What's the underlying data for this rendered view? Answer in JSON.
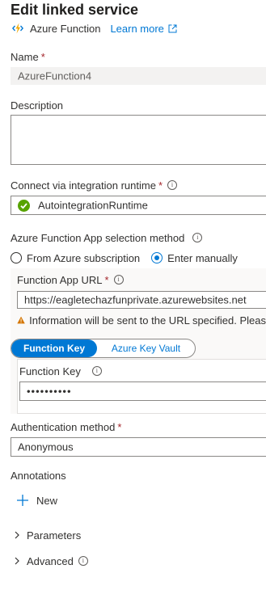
{
  "header": {
    "title": "Edit linked service",
    "service_type": "Azure Function",
    "learn_more": "Learn more"
  },
  "name": {
    "label": "Name",
    "required": "*",
    "value": "AzureFunction4"
  },
  "description": {
    "label": "Description",
    "value": ""
  },
  "runtime": {
    "label": "Connect via integration runtime",
    "required": "*",
    "value": "AutointegrationRuntime"
  },
  "selection_method": {
    "label": "Azure Function App selection method",
    "options": [
      "From Azure subscription",
      "Enter manually"
    ],
    "selected": "Enter manually"
  },
  "function_app_url": {
    "label": "Function App URL",
    "required": "*",
    "value": "https://eagletechazfunprivate.azurewebsites.net",
    "warning": "Information will be sent to the URL specified. Pleas"
  },
  "key_source": {
    "options": [
      "Function Key",
      "Azure Key Vault"
    ],
    "selected": "Function Key"
  },
  "function_key": {
    "label": "Function Key",
    "value": "••••••••••"
  },
  "auth": {
    "label": "Authentication method",
    "required": "*",
    "value": "Anonymous"
  },
  "annotations": {
    "label": "Annotations",
    "new_label": "New"
  },
  "sections": {
    "parameters": "Parameters",
    "advanced": "Advanced"
  },
  "colors": {
    "accent": "#0078d4",
    "success": "#57a300",
    "warning": "#d47500",
    "required": "#a4262c"
  }
}
